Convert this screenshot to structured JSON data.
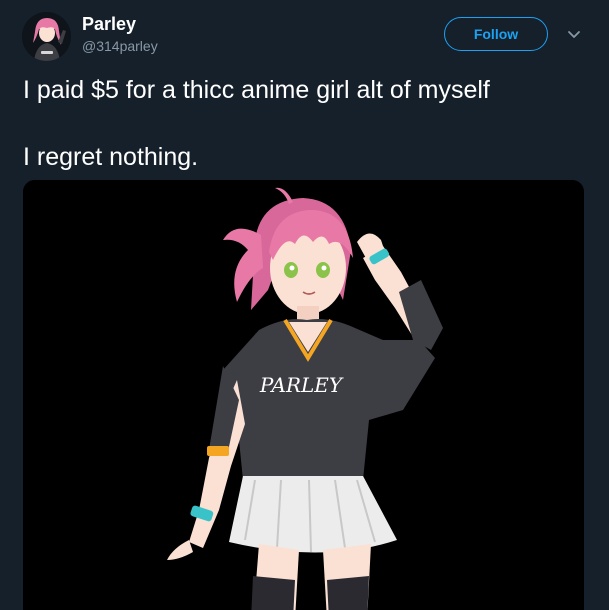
{
  "user": {
    "display_name": "Parley",
    "handle": "@314parley"
  },
  "follow_button": {
    "label": "Follow"
  },
  "more_menu": {
    "icon": "chevron-down-icon"
  },
  "tweet": {
    "text_line_1": "I paid $5 for a thicc anime girl alt of myself",
    "text_line_2": "I regret nothing."
  },
  "media": {
    "shirt_text": "PARLEY"
  },
  "colors": {
    "background": "#15202b",
    "accent": "#1da1f2",
    "secondary_text": "#8899a6",
    "hair": "#e879a6",
    "shirt": "#3d3d44",
    "trim": "#f4a623",
    "band": "#39c3c9"
  }
}
